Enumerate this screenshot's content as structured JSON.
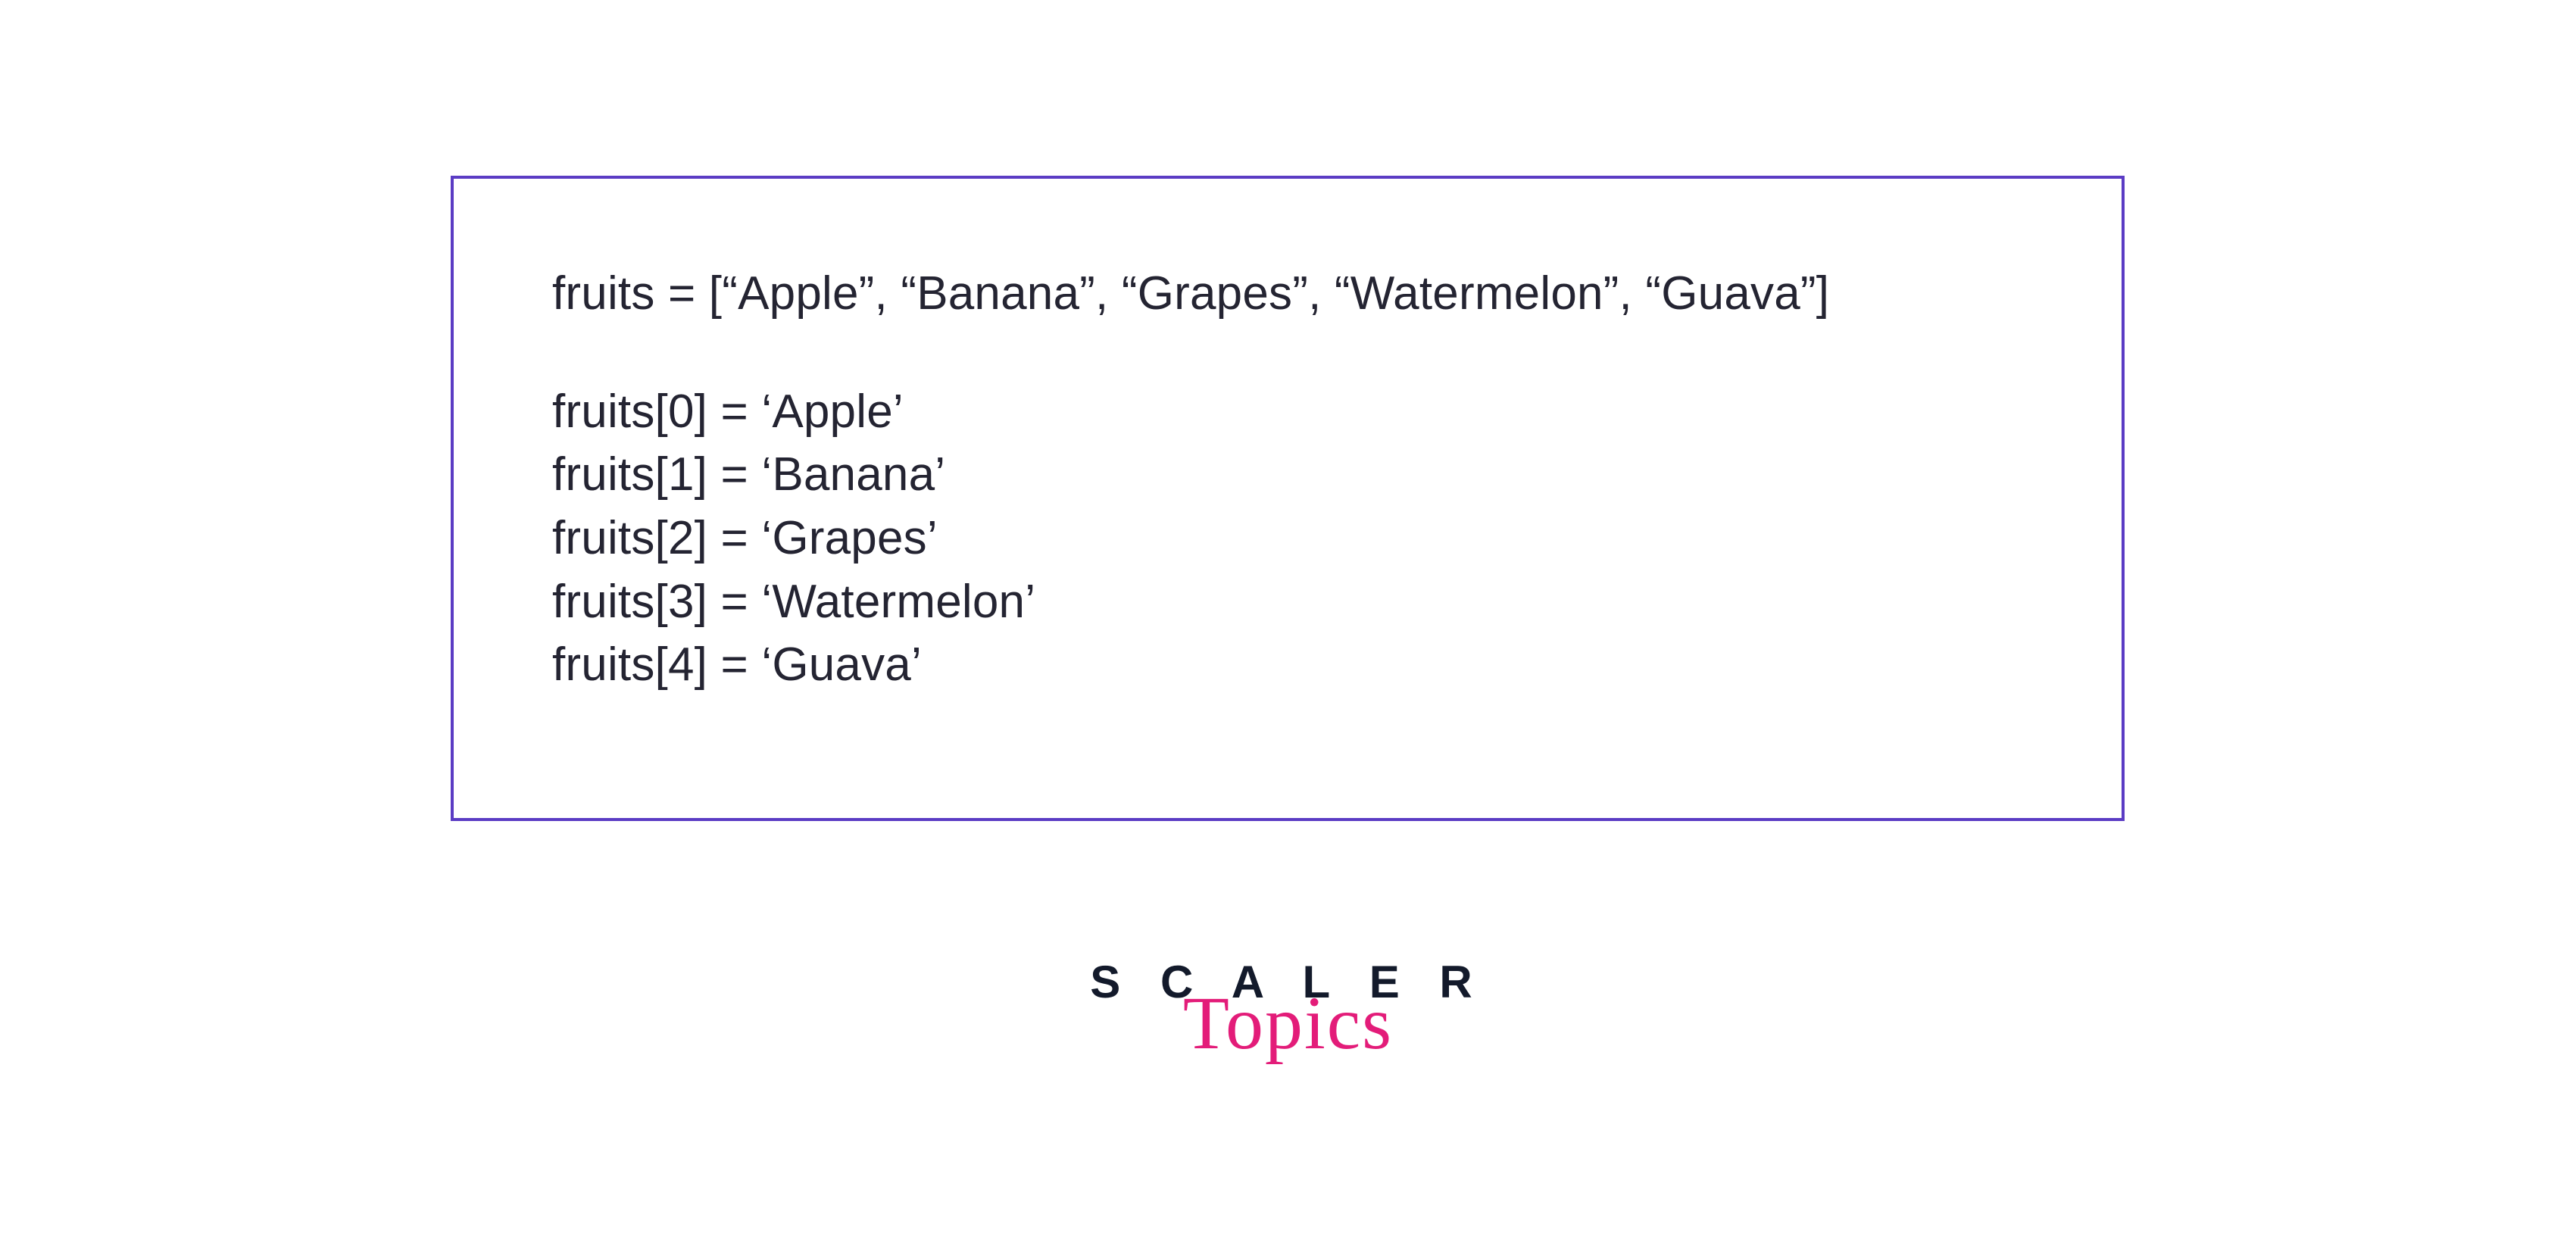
{
  "code": {
    "declaration": "fruits = [“Apple”, “Banana”, “Grapes”, “Watermelon”, “Guava”]",
    "lines": [
      "fruits[0] = ‘Apple’",
      "fruits[1] = ‘Banana’",
      "fruits[2] = ‘Grapes’",
      "fruits[3] = ‘Watermelon’",
      "fruits[4] = ‘Guava’"
    ]
  },
  "logo": {
    "line1": "S C A L E R",
    "line2": "Topics"
  },
  "colors": {
    "border": "#5b3cc4",
    "text": "#242432",
    "logoDark": "#131a2b",
    "logoPink": "#e31c79"
  }
}
